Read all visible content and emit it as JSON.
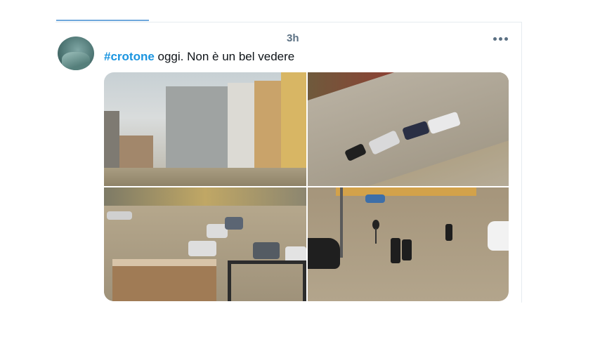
{
  "tweet": {
    "timestamp": "3h",
    "hashtag": "#crotone",
    "text": " oggi. Non è un bel vedere"
  },
  "colors": {
    "hashtag": "#1b95e0",
    "text": "#0f1419",
    "meta": "#5b7083",
    "tab_underline": "#6fa8dc"
  },
  "icons": {
    "more": "more-horizontal-icon"
  },
  "media": {
    "count": 4
  }
}
